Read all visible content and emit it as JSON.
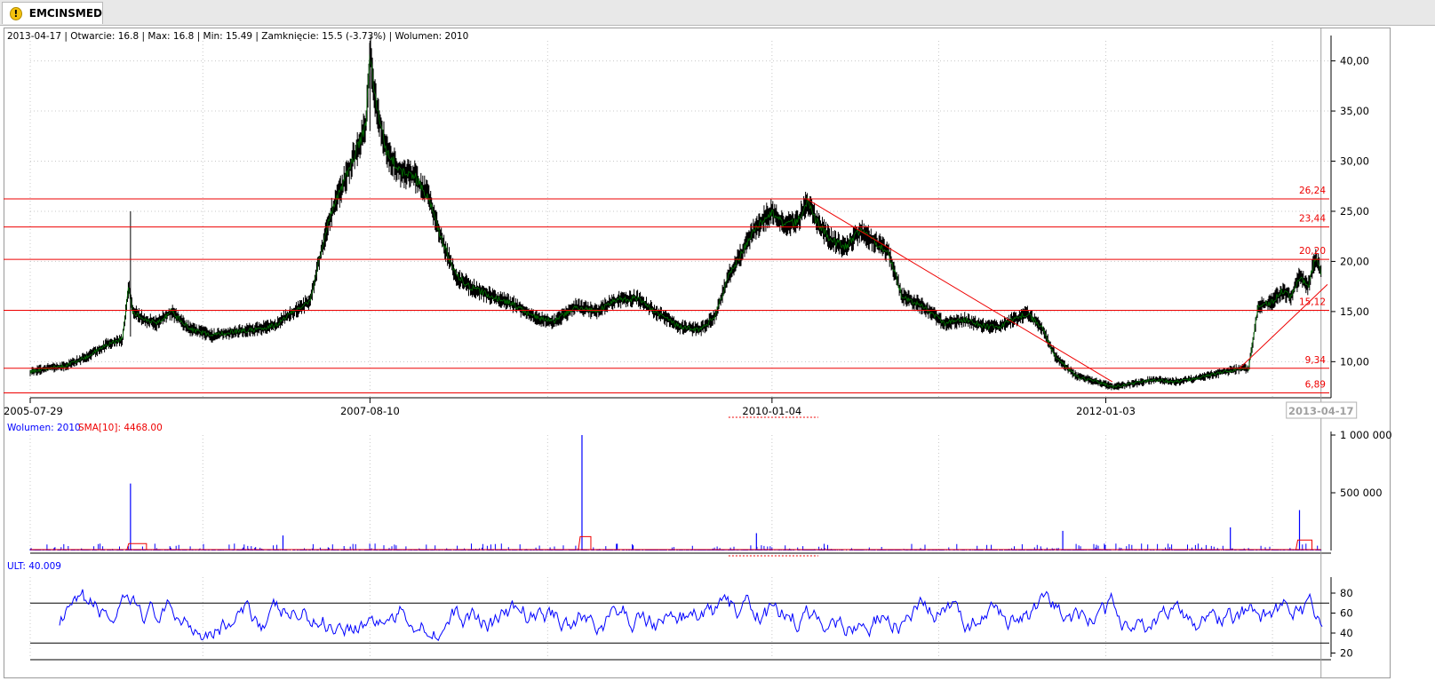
{
  "tab": {
    "title": "EMCINSMED",
    "icon": "warning-icon"
  },
  "info_line": "2013-04-17 | Otwarcie: 16.8 | Max: 16.8 | Min: 15.49 | Zamknięcie: 15.5 (-3.73%)  | Wolumen: 2010",
  "colors": {
    "price": "#000000",
    "price_trend": "#008000",
    "levels": "#ee0000",
    "volume": "#0000ff",
    "sma": "#ee0000",
    "ult": "#0000ff"
  },
  "chart_data": [
    {
      "type": "line",
      "panel": "price",
      "x_ticks": [
        "2005-07-29",
        "2007-08-10",
        "2010-01-04",
        "2012-01-03"
      ],
      "cursor_label": "2013-04-17",
      "y_ticks": [
        "40,00",
        "35,00",
        "30,00",
        "25,00",
        "20,00",
        "15,00",
        "10,00"
      ],
      "ylim": [
        6.4,
        42
      ],
      "levels": [
        {
          "label": "26,24",
          "value": 26.24
        },
        {
          "label": "23,44",
          "value": 23.44
        },
        {
          "label": "20,20",
          "value": 20.2
        },
        {
          "label": "15,12",
          "value": 15.12
        },
        {
          "label": "9,34",
          "value": 9.34
        },
        {
          "label": "6,89",
          "value": 6.89
        }
      ],
      "trendlines": [
        {
          "from": [
            "2010-03-22",
            26.2
          ],
          "to": [
            "2012-01-17",
            8.0
          ]
        },
        {
          "from": [
            "2012-10-20",
            9.3
          ],
          "to": [
            "2013-05-01",
            17.7
          ]
        }
      ],
      "series": [
        {
          "x": [
            "2005-07-29",
            "2005-09-01",
            "2005-10-15",
            "2005-12-01",
            "2006-01-15",
            "2006-02-15",
            "2006-03-01",
            "2006-03-10",
            "2006-04-01",
            "2006-05-01",
            "2006-06-01",
            "2006-07-15",
            "2006-09-01",
            "2006-10-15",
            "2006-12-01",
            "2007-01-15",
            "2007-03-01",
            "2007-04-01",
            "2007-04-20",
            "2007-05-15",
            "2007-06-15",
            "2007-07-15",
            "2007-08-01",
            "2007-08-10",
            "2007-08-20",
            "2007-09-15",
            "2007-10-15",
            "2007-11-15",
            "2007-12-15",
            "2008-01-15",
            "2008-02-15",
            "2008-03-15",
            "2008-05-01",
            "2008-06-15",
            "2008-08-01",
            "2008-09-15",
            "2008-11-01",
            "2008-12-15",
            "2009-02-01",
            "2009-03-15",
            "2009-05-01",
            "2009-06-15",
            "2009-08-01",
            "2009-09-01",
            "2009-10-01",
            "2009-11-01",
            "2009-12-01",
            "2010-01-04",
            "2010-02-01",
            "2010-03-01",
            "2010-03-22",
            "2010-04-15",
            "2010-05-15",
            "2010-06-15",
            "2010-07-15",
            "2010-08-15",
            "2010-09-15",
            "2010-10-15",
            "2010-12-01",
            "2011-01-15",
            "2011-03-01",
            "2011-04-15",
            "2011-05-15",
            "2011-06-15",
            "2011-07-15",
            "2011-08-15",
            "2011-09-15",
            "2011-11-01",
            "2011-12-15",
            "2012-01-17",
            "2012-03-01",
            "2012-04-15",
            "2012-06-01",
            "2012-07-15",
            "2012-09-01",
            "2012-10-20",
            "2012-11-10",
            "2012-12-01",
            "2013-01-01",
            "2013-01-20",
            "2013-02-10",
            "2013-03-01",
            "2013-03-20",
            "2013-04-05",
            "2013-04-17"
          ],
          "values": [
            9.0,
            9.3,
            9.6,
            10.5,
            11.8,
            12.2,
            17.5,
            15.0,
            14.3,
            13.8,
            15.0,
            13.2,
            12.6,
            13.0,
            13.2,
            13.6,
            15.2,
            16.0,
            20.0,
            24.5,
            28.0,
            31.5,
            33.5,
            41.0,
            36.5,
            31.0,
            29.0,
            28.5,
            26.5,
            22.0,
            18.5,
            17.5,
            16.5,
            15.8,
            14.5,
            14.0,
            15.5,
            15.0,
            16.2,
            16.3,
            14.8,
            13.5,
            13.2,
            14.5,
            18.5,
            21.0,
            23.5,
            25.0,
            23.5,
            24.0,
            26.0,
            23.8,
            22.0,
            21.5,
            23.0,
            22.0,
            21.0,
            16.5,
            15.5,
            13.8,
            14.2,
            13.5,
            13.5,
            14.2,
            14.8,
            13.5,
            10.5,
            8.5,
            8.0,
            7.5,
            7.8,
            8.2,
            8.0,
            8.3,
            8.8,
            9.3,
            9.3,
            15.5,
            16.0,
            17.0,
            16.5,
            18.5,
            17.5,
            20.5,
            18.8
          ]
        }
      ]
    },
    {
      "type": "bar",
      "panel": "volume",
      "label": "Wolumen: 2010",
      "sma_label": "SMA[10]: 4468.00",
      "y_ticks": [
        "1 000 000",
        "500 000"
      ],
      "ylim": [
        0,
        1000000
      ],
      "spikes": [
        {
          "x": "2006-03-05",
          "value": 580000
        },
        {
          "x": "2007-02-01",
          "value": 130000
        },
        {
          "x": "2008-11-15",
          "value": 1000000
        },
        {
          "x": "2009-12-01",
          "value": 150000
        },
        {
          "x": "2011-10-01",
          "value": 170000
        },
        {
          "x": "2012-10-01",
          "value": 200000
        },
        {
          "x": "2013-03-01",
          "value": 350000
        }
      ]
    },
    {
      "type": "line",
      "panel": "oscillator",
      "label": "ULT: 40.009",
      "y_ticks": [
        "80",
        "60",
        "40",
        "20"
      ],
      "ylim": [
        16,
        96
      ],
      "reference_lines": [
        70,
        30
      ]
    }
  ]
}
